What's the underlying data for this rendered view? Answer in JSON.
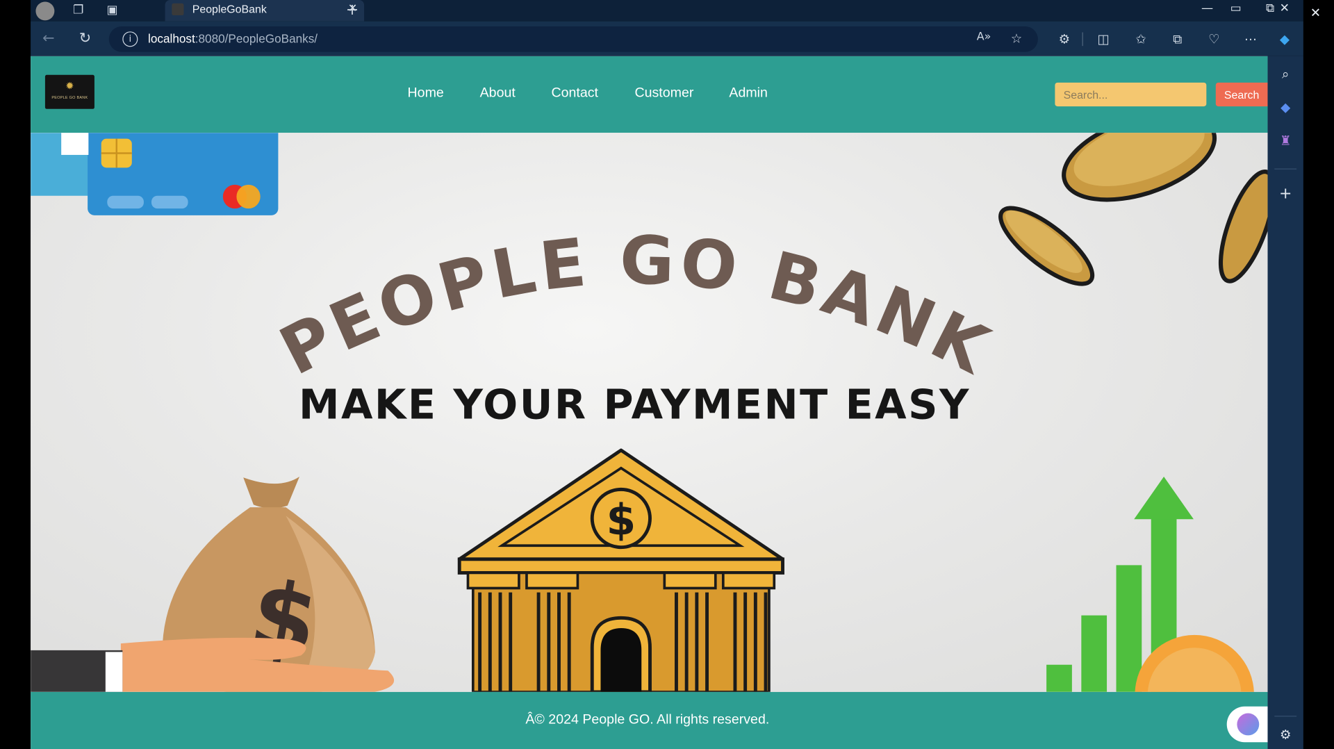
{
  "browser": {
    "tab_title": "PeopleGoBank",
    "url_host": "localhost",
    "url_path": ":8080/PeopleGoBanks/"
  },
  "site": {
    "logo_text": "PEOPLE GO BANK",
    "nav": [
      "Home",
      "About",
      "Contact",
      "Customer",
      "Admin"
    ],
    "search": {
      "placeholder": "Search...",
      "button": "Search"
    },
    "hero": {
      "title": "PEOPLE GO BANK",
      "tagline": "MAKE YOUR PAYMENT EASY",
      "bank_symbol": "$",
      "bag_symbol": "$"
    },
    "footer": "Â© 2024 People GO. All rights reserved."
  },
  "colors": {
    "header": "#2d9e92",
    "search_field": "#f4c770",
    "search_button": "#ee6b52",
    "title_text": "#6e5b52",
    "bank_gold": "#f0b43a",
    "chart_green": "#4fbf3e"
  }
}
